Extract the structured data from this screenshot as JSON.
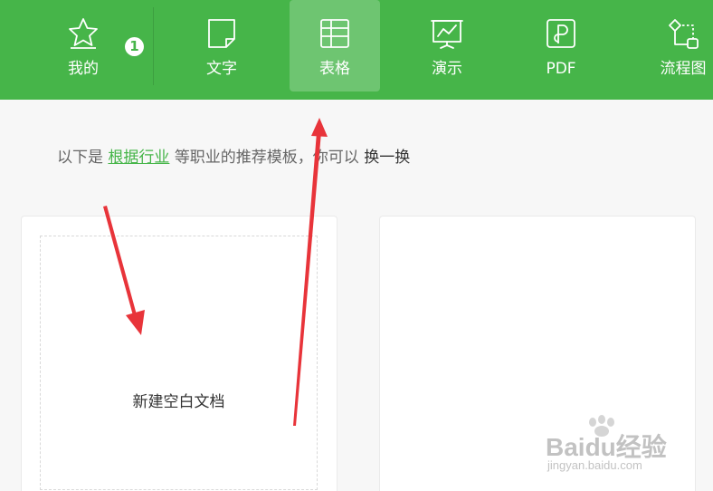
{
  "tabs": [
    {
      "label": "我的",
      "icon": "star-icon",
      "badge": "1"
    },
    {
      "label": "文字",
      "icon": "document-icon"
    },
    {
      "label": "表格",
      "icon": "spreadsheet-icon",
      "active": true
    },
    {
      "label": "演示",
      "icon": "presentation-icon"
    },
    {
      "label": "PDF",
      "icon": "pdf-icon"
    },
    {
      "label": "流程图",
      "icon": "flowchart-icon"
    }
  ],
  "recommend": {
    "prefix": "以下是",
    "link": "根据行业",
    "middle": "等职业的推荐模板，你可以",
    "swap": "换一换"
  },
  "cards": {
    "blank_doc_label": "新建空白文档"
  },
  "watermark": {
    "logo": "Baidu经验",
    "url": "jingyan.baidu.com"
  },
  "colors": {
    "accent": "#46b549",
    "annotation_arrow": "#e8343a",
    "background": "#f7f7f7"
  }
}
